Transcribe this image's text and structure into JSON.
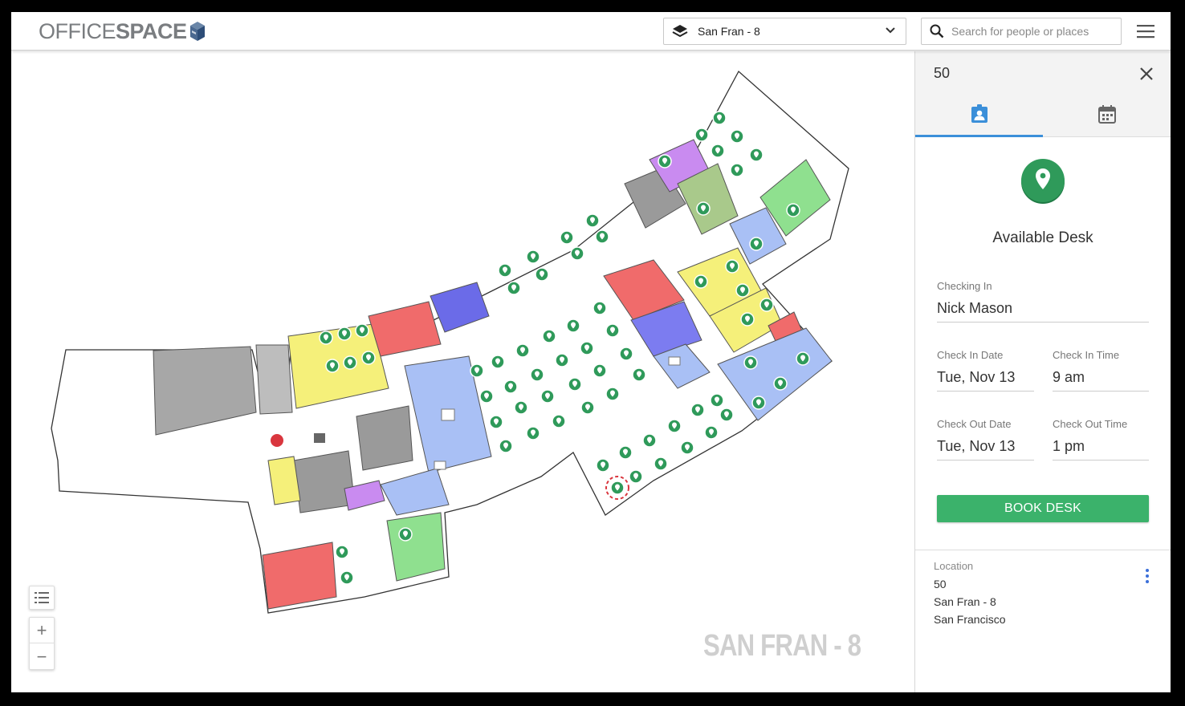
{
  "header": {
    "logo_text_1": "OFFICE",
    "logo_text_2": "SPACE",
    "building_select_value": "San Fran - 8",
    "search_placeholder": "Search for people or places"
  },
  "map": {
    "floor_watermark": "SAN FRAN - 8",
    "zoom_in_label": "+",
    "zoom_out_label": "−"
  },
  "panel": {
    "title": "50",
    "status": "Available Desk",
    "checking_in_label": "Checking In",
    "checking_in_value": "Nick Mason",
    "check_in_date_label": "Check In Date",
    "check_in_date_value": "Tue, Nov 13",
    "check_in_time_label": "Check In Time",
    "check_in_time_value": "9 am",
    "check_out_date_label": "Check Out Date",
    "check_out_date_value": "Tue, Nov 13",
    "check_out_time_label": "Check Out Time",
    "check_out_time_value": "1 pm",
    "book_button": "BOOK DESK",
    "location_label": "Location",
    "location_lines": [
      "50",
      "San Fran - 8",
      "San Francisco"
    ]
  },
  "colors": {
    "accent_blue": "#3b8fd9",
    "available_green": "#3bb26b",
    "room_red": "#f06b6b",
    "room_yellow": "#f5f07a",
    "room_blue": "#a9c0f5",
    "room_green": "#8fe08f",
    "room_purple": "#c98bf0",
    "room_gray": "#9a9a9a"
  }
}
